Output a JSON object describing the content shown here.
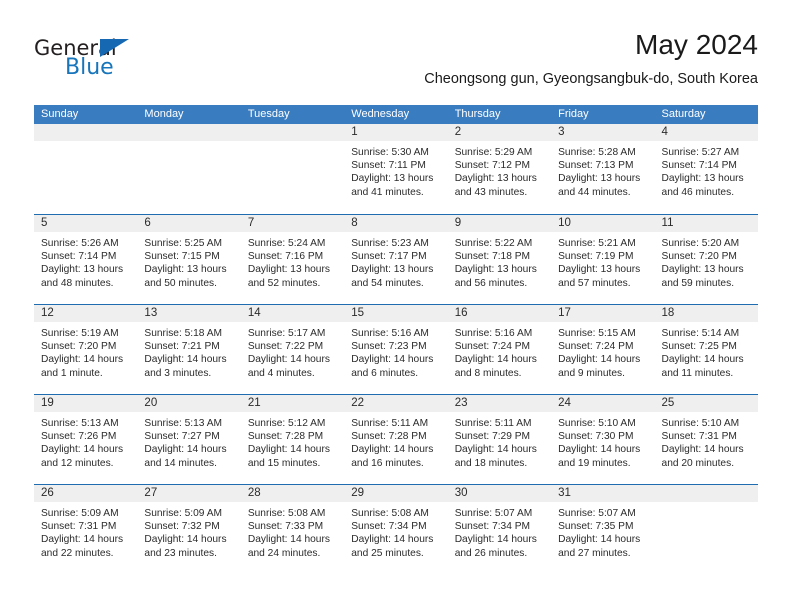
{
  "brand": {
    "name_part1": "General",
    "name_part2": "Blue",
    "triangle_icon": "triangle-icon",
    "accent_color": "#1775bb"
  },
  "header": {
    "title": "May 2024",
    "subtitle": "Cheongsong gun, Gyeongsangbuk-do, South Korea"
  },
  "calendar": {
    "header_color": "#3a7cc0",
    "row_divider_color": "#1f6cb0",
    "daynumber_band_color": "#efefef",
    "weekdays": [
      "Sunday",
      "Monday",
      "Tuesday",
      "Wednesday",
      "Thursday",
      "Friday",
      "Saturday"
    ],
    "weeks": [
      [
        {
          "day": "",
          "lines": []
        },
        {
          "day": "",
          "lines": []
        },
        {
          "day": "",
          "lines": []
        },
        {
          "day": "1",
          "lines": [
            "Sunrise: 5:30 AM",
            "Sunset: 7:11 PM",
            "Daylight: 13 hours",
            "and 41 minutes."
          ]
        },
        {
          "day": "2",
          "lines": [
            "Sunrise: 5:29 AM",
            "Sunset: 7:12 PM",
            "Daylight: 13 hours",
            "and 43 minutes."
          ]
        },
        {
          "day": "3",
          "lines": [
            "Sunrise: 5:28 AM",
            "Sunset: 7:13 PM",
            "Daylight: 13 hours",
            "and 44 minutes."
          ]
        },
        {
          "day": "4",
          "lines": [
            "Sunrise: 5:27 AM",
            "Sunset: 7:14 PM",
            "Daylight: 13 hours",
            "and 46 minutes."
          ]
        }
      ],
      [
        {
          "day": "5",
          "lines": [
            "Sunrise: 5:26 AM",
            "Sunset: 7:14 PM",
            "Daylight: 13 hours",
            "and 48 minutes."
          ]
        },
        {
          "day": "6",
          "lines": [
            "Sunrise: 5:25 AM",
            "Sunset: 7:15 PM",
            "Daylight: 13 hours",
            "and 50 minutes."
          ]
        },
        {
          "day": "7",
          "lines": [
            "Sunrise: 5:24 AM",
            "Sunset: 7:16 PM",
            "Daylight: 13 hours",
            "and 52 minutes."
          ]
        },
        {
          "day": "8",
          "lines": [
            "Sunrise: 5:23 AM",
            "Sunset: 7:17 PM",
            "Daylight: 13 hours",
            "and 54 minutes."
          ]
        },
        {
          "day": "9",
          "lines": [
            "Sunrise: 5:22 AM",
            "Sunset: 7:18 PM",
            "Daylight: 13 hours",
            "and 56 minutes."
          ]
        },
        {
          "day": "10",
          "lines": [
            "Sunrise: 5:21 AM",
            "Sunset: 7:19 PM",
            "Daylight: 13 hours",
            "and 57 minutes."
          ]
        },
        {
          "day": "11",
          "lines": [
            "Sunrise: 5:20 AM",
            "Sunset: 7:20 PM",
            "Daylight: 13 hours",
            "and 59 minutes."
          ]
        }
      ],
      [
        {
          "day": "12",
          "lines": [
            "Sunrise: 5:19 AM",
            "Sunset: 7:20 PM",
            "Daylight: 14 hours",
            "and 1 minute."
          ]
        },
        {
          "day": "13",
          "lines": [
            "Sunrise: 5:18 AM",
            "Sunset: 7:21 PM",
            "Daylight: 14 hours",
            "and 3 minutes."
          ]
        },
        {
          "day": "14",
          "lines": [
            "Sunrise: 5:17 AM",
            "Sunset: 7:22 PM",
            "Daylight: 14 hours",
            "and 4 minutes."
          ]
        },
        {
          "day": "15",
          "lines": [
            "Sunrise: 5:16 AM",
            "Sunset: 7:23 PM",
            "Daylight: 14 hours",
            "and 6 minutes."
          ]
        },
        {
          "day": "16",
          "lines": [
            "Sunrise: 5:16 AM",
            "Sunset: 7:24 PM",
            "Daylight: 14 hours",
            "and 8 minutes."
          ]
        },
        {
          "day": "17",
          "lines": [
            "Sunrise: 5:15 AM",
            "Sunset: 7:24 PM",
            "Daylight: 14 hours",
            "and 9 minutes."
          ]
        },
        {
          "day": "18",
          "lines": [
            "Sunrise: 5:14 AM",
            "Sunset: 7:25 PM",
            "Daylight: 14 hours",
            "and 11 minutes."
          ]
        }
      ],
      [
        {
          "day": "19",
          "lines": [
            "Sunrise: 5:13 AM",
            "Sunset: 7:26 PM",
            "Daylight: 14 hours",
            "and 12 minutes."
          ]
        },
        {
          "day": "20",
          "lines": [
            "Sunrise: 5:13 AM",
            "Sunset: 7:27 PM",
            "Daylight: 14 hours",
            "and 14 minutes."
          ]
        },
        {
          "day": "21",
          "lines": [
            "Sunrise: 5:12 AM",
            "Sunset: 7:28 PM",
            "Daylight: 14 hours",
            "and 15 minutes."
          ]
        },
        {
          "day": "22",
          "lines": [
            "Sunrise: 5:11 AM",
            "Sunset: 7:28 PM",
            "Daylight: 14 hours",
            "and 16 minutes."
          ]
        },
        {
          "day": "23",
          "lines": [
            "Sunrise: 5:11 AM",
            "Sunset: 7:29 PM",
            "Daylight: 14 hours",
            "and 18 minutes."
          ]
        },
        {
          "day": "24",
          "lines": [
            "Sunrise: 5:10 AM",
            "Sunset: 7:30 PM",
            "Daylight: 14 hours",
            "and 19 minutes."
          ]
        },
        {
          "day": "25",
          "lines": [
            "Sunrise: 5:10 AM",
            "Sunset: 7:31 PM",
            "Daylight: 14 hours",
            "and 20 minutes."
          ]
        }
      ],
      [
        {
          "day": "26",
          "lines": [
            "Sunrise: 5:09 AM",
            "Sunset: 7:31 PM",
            "Daylight: 14 hours",
            "and 22 minutes."
          ]
        },
        {
          "day": "27",
          "lines": [
            "Sunrise: 5:09 AM",
            "Sunset: 7:32 PM",
            "Daylight: 14 hours",
            "and 23 minutes."
          ]
        },
        {
          "day": "28",
          "lines": [
            "Sunrise: 5:08 AM",
            "Sunset: 7:33 PM",
            "Daylight: 14 hours",
            "and 24 minutes."
          ]
        },
        {
          "day": "29",
          "lines": [
            "Sunrise: 5:08 AM",
            "Sunset: 7:34 PM",
            "Daylight: 14 hours",
            "and 25 minutes."
          ]
        },
        {
          "day": "30",
          "lines": [
            "Sunrise: 5:07 AM",
            "Sunset: 7:34 PM",
            "Daylight: 14 hours",
            "and 26 minutes."
          ]
        },
        {
          "day": "31",
          "lines": [
            "Sunrise: 5:07 AM",
            "Sunset: 7:35 PM",
            "Daylight: 14 hours",
            "and 27 minutes."
          ]
        },
        {
          "day": "",
          "lines": []
        }
      ]
    ]
  }
}
